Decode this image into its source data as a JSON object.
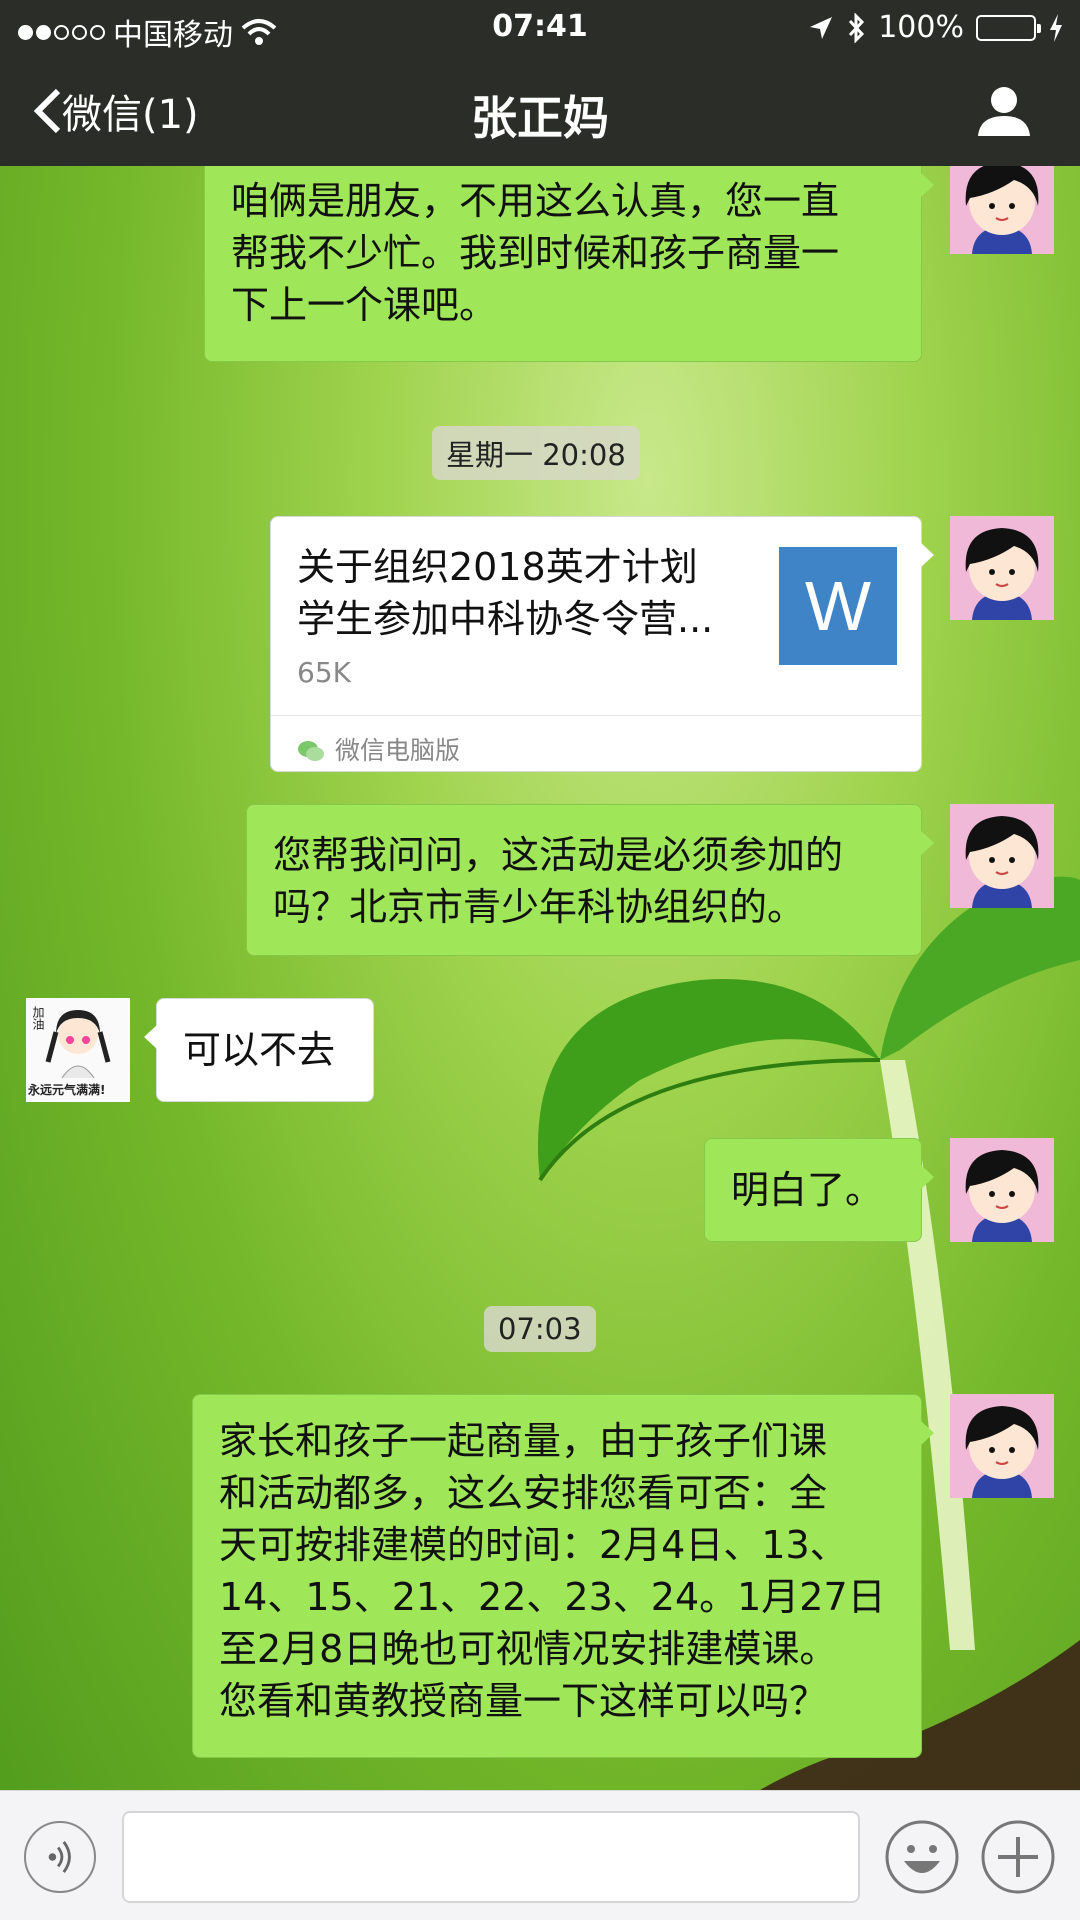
{
  "status_bar": {
    "carrier": "中国移动",
    "time": "07:41",
    "battery": "100%",
    "colors": {
      "battery_fill": "#4cd964"
    },
    "icons": [
      "signal-dots-icon",
      "wifi-icon",
      "location-arrow-icon",
      "bluetooth-icon",
      "battery-icon",
      "charging-bolt-icon"
    ]
  },
  "nav": {
    "back_label": "微信(1)",
    "title": "张正妈",
    "icons": [
      "chevron-left-icon",
      "profile-icon"
    ]
  },
  "messages": [
    {
      "side": "right",
      "type": "text",
      "text_lines": [
        "咱俩是朋友，不用这么认真，您一直",
        "帮我不少忙。我到时候和孩子商量一",
        "下上一个课吧。"
      ]
    },
    {
      "type": "timestamp",
      "text": "星期一 20:08"
    },
    {
      "side": "right",
      "type": "file",
      "title_lines": [
        "关于组织2018英才计划",
        "学生参加中科协冬令营..."
      ],
      "size": "65K",
      "icon_letter": "W",
      "source": "微信电脑版"
    },
    {
      "side": "right",
      "type": "text",
      "text_lines": [
        "您帮我问问，这活动是必须参加的",
        "吗？北京市青少年科协组织的。"
      ]
    },
    {
      "side": "left",
      "type": "text",
      "text": "可以不去",
      "avatar_text": [
        "加油",
        "永远元气满满!"
      ]
    },
    {
      "side": "right",
      "type": "text",
      "text": "明白了。"
    },
    {
      "type": "timestamp",
      "text": "07:03"
    },
    {
      "side": "right",
      "type": "text",
      "text_lines": [
        "家长和孩子一起商量，由于孩子们课",
        "和活动都多，这么安排您看可否：全",
        "天可按排建模的时间：2月4日、13、",
        "14、15、21、22、23、24。1月27日",
        "至2月8日晚也可视情况安排建模课。",
        "您看和黄教授商量一下这样可以吗？"
      ]
    }
  ],
  "input_bar": {
    "value": "",
    "icons": [
      "voice-icon",
      "emoji-icon",
      "plus-icon"
    ]
  },
  "colors": {
    "nav_bg": "#2b2d29",
    "bubble_green": "#9fe658",
    "bubble_white": "#ffffff",
    "file_icon_blue": "#3f84c6"
  }
}
